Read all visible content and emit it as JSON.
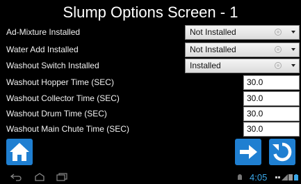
{
  "title": "Slump Options Screen - 1",
  "rows": [
    {
      "label": "Ad-Mixture Installed",
      "value": "Not Installed"
    },
    {
      "label": "Water Add Installed",
      "value": "Not Installed"
    },
    {
      "label": "Washout Switch Installed",
      "value": "Installed"
    },
    {
      "label": "Washout Hopper Time (SEC)",
      "value": "30.0"
    },
    {
      "label": "Washout Collector Time (SEC)",
      "value": "30.0"
    },
    {
      "label": "Washout Drum Time (SEC)",
      "value": "30.0"
    },
    {
      "label": "Washout Main Chute Time (SEC)",
      "value": "30.0"
    }
  ],
  "status_bar": {
    "time": "4:05"
  },
  "colors": {
    "accent": "#1f7fd1",
    "clock": "#3aa7e8",
    "background": "#000000"
  }
}
